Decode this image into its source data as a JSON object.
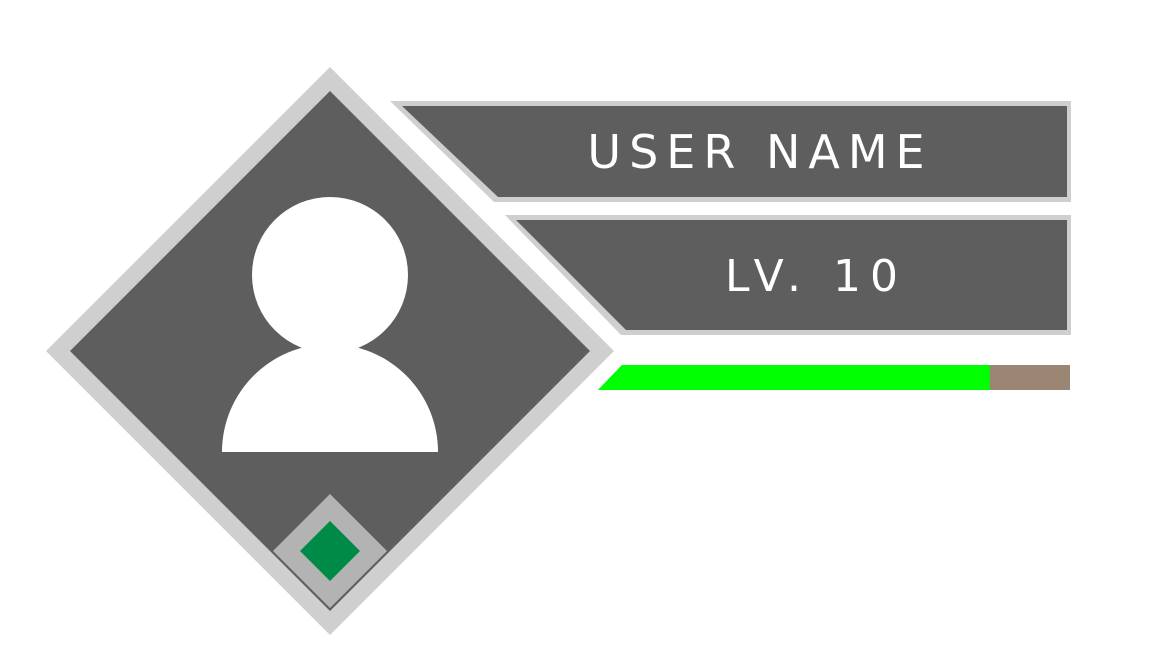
{
  "player": {
    "name": "USER NAME",
    "level_label": "LV. 10",
    "xp_fraction": 0.83
  },
  "icons": {
    "avatar": "user-silhouette-icon",
    "rank": "green-diamond-gem-icon"
  },
  "colors": {
    "panel_fill": "#5e5e5e",
    "panel_border": "#cfcfcf",
    "xp_fill": "#00ff00",
    "xp_track": "#9a8672",
    "rank_gem": "#008a47",
    "rank_frame": "#b3b3b3",
    "text": "#ffffff"
  }
}
